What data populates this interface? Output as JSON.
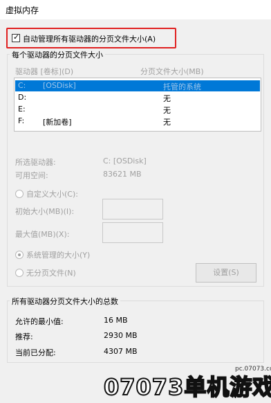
{
  "window": {
    "title": "虚拟内存"
  },
  "auto_manage": {
    "label": "自动管理所有驱动器的分页文件大小(A)",
    "checked": true
  },
  "drives_group": {
    "legend": "每个驱动器的分页文件大小",
    "col_drive": "驱动器 [卷标](D)",
    "col_size": "分页文件大小(MB)",
    "rows": [
      {
        "drive": "C:",
        "label": "[OSDisk]",
        "size": "托管的系统"
      },
      {
        "drive": "D:",
        "label": "",
        "size": "无"
      },
      {
        "drive": "E:",
        "label": "",
        "size": "无"
      },
      {
        "drive": "F:",
        "label": "[新加卷]",
        "size": "无"
      }
    ]
  },
  "selected_drive": {
    "label": "所选驱动器:",
    "value": "C:  [OSDisk]"
  },
  "free_space": {
    "label": "可用空间:",
    "value": "83621 MB"
  },
  "custom_size": {
    "label": "自定义大小(C):"
  },
  "initial_size": {
    "label": "初始大小(MB)(I):",
    "value": ""
  },
  "max_size": {
    "label": "最大值(MB)(X):",
    "value": ""
  },
  "system_managed": {
    "label": "系统管理的大小(Y)",
    "selected": true
  },
  "no_paging": {
    "label": "无分页文件(N)"
  },
  "set_button": {
    "label": "设置(S)"
  },
  "totals_group": {
    "legend": "所有驱动器分页文件大小的总数",
    "min_label": "允许的最小值:",
    "min_value": "16 MB",
    "recommended_label": "推荐:",
    "recommended_value": "2930 MB",
    "allocated_label": "当前已分配:",
    "allocated_value": "4307 MB"
  },
  "watermark": {
    "text": "07073单机游戏",
    "url": "pc.07073.com"
  }
}
